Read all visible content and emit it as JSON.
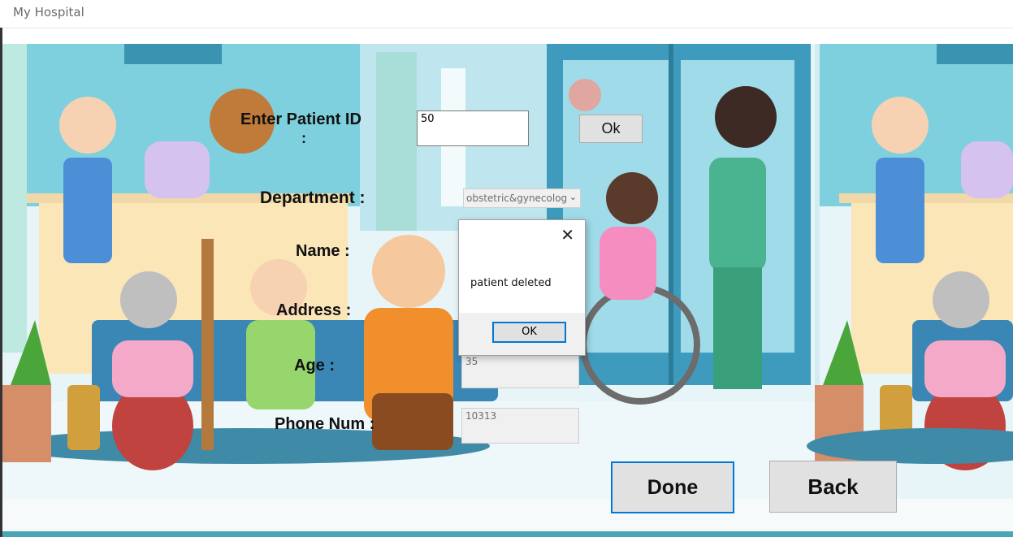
{
  "window": {
    "title": "My Hospital"
  },
  "form": {
    "patient_id_label": "Enter Patient ID",
    "patient_id_colon": ":",
    "patient_id_value": "50",
    "ok_button": "Ok",
    "department_label": "Department :",
    "department_value": "obstetric&gynecolog",
    "name_label": "Name :",
    "address_label": "Address :",
    "age_label": "Age :",
    "age_value": "35",
    "phone_label": "Phone Num :",
    "phone_value": "10313",
    "done_button": "Done",
    "back_button": "Back"
  },
  "dialog": {
    "message": "patient deleted",
    "ok_button": "OK"
  },
  "icons": {
    "close": "close-icon",
    "dropdown": "chevron-down-icon"
  },
  "colors": {
    "accent": "#0078d7",
    "wall": "#6cc7d8",
    "sky": "#dff2f5"
  }
}
